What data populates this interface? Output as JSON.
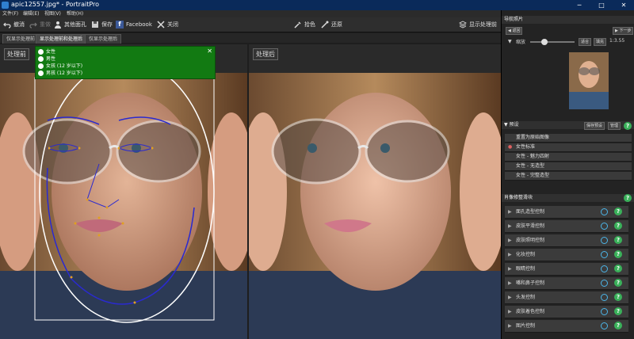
{
  "window": {
    "title": "apic12557.jpg* - PortraitPro",
    "controls": [
      "─",
      "□",
      "✕"
    ]
  },
  "menu": [
    "文件(F)",
    "编辑(E)",
    "视图(V)",
    "帮助(H)"
  ],
  "toolbar": {
    "undo": "撤消",
    "redo": "重做",
    "other_faces": "其他面孔",
    "save": "保存",
    "facebook": "Facebook",
    "close": "关闭",
    "color_pick": "拾色",
    "restore": "还原",
    "show_processed": "显示处理前"
  },
  "tabs": [
    "仅显示处理前",
    "显示处理前和处理后",
    "仅显示处理后"
  ],
  "labels": {
    "before": "处理前",
    "after": "处理后"
  },
  "popup": {
    "options": [
      "女性",
      "男性",
      "女孩 (12 岁以下)",
      "男孩 (12 岁以下)"
    ],
    "close": "✕"
  },
  "right_panel": {
    "navigator_title": "导航照片",
    "back": "返回",
    "next": "下一步",
    "zoom_label": "缩放",
    "fit": "适合",
    "fill": "填充",
    "ratio": "1:3.55",
    "presets_title": "预设",
    "save_preset": "保存预设",
    "manage": "管理",
    "presets": [
      "重置为原始图像",
      "女性标准",
      "女性 - 魅力四射",
      "女性 - 无造型",
      "女性 - 完整造型"
    ],
    "sliders_title": "肖像修整滑块",
    "controls": [
      "面孔造型控制",
      "皮肤平滑控制",
      "皮肤照明控制",
      "化妆控制",
      "眼睛控制",
      "嘴和鼻子控制",
      "头发控制",
      "皮肤着色控制",
      "图片控制"
    ],
    "help": "?"
  },
  "colors": {
    "accent_green": "#127a12",
    "help_green": "#3ab15a",
    "power_blue": "#4bb5e8",
    "title_bar": "#0a2a5a"
  }
}
